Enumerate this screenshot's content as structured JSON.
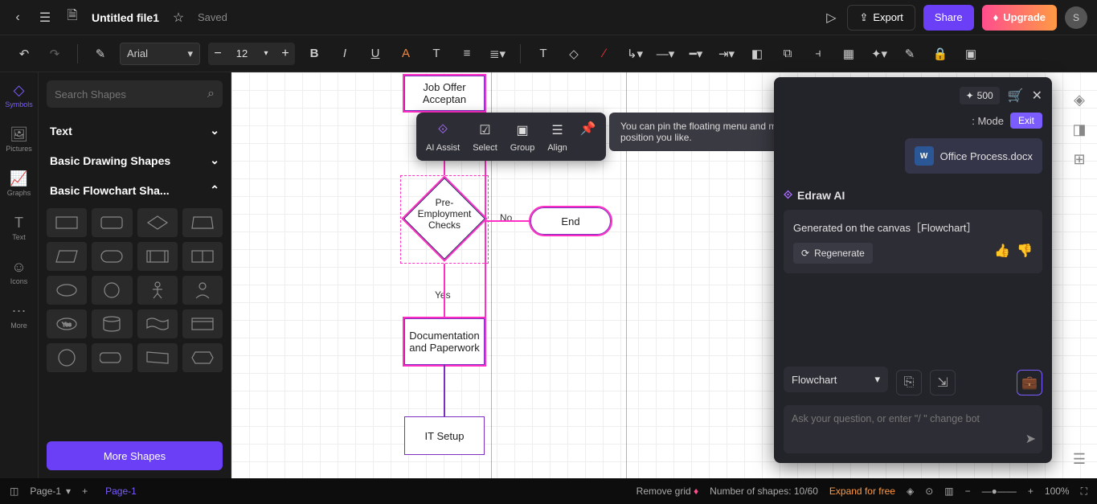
{
  "topbar": {
    "title": "Untitled file1",
    "saved": "Saved",
    "export": "Export",
    "share": "Share",
    "upgrade": "Upgrade",
    "avatar": "S"
  },
  "toolbar": {
    "font": "Arial",
    "size": "12"
  },
  "rail": [
    {
      "label": "Symbols",
      "active": true
    },
    {
      "label": "Pictures",
      "active": false
    },
    {
      "label": "Graphs",
      "active": false
    },
    {
      "label": "Text",
      "active": false
    },
    {
      "label": "Icons",
      "active": false
    },
    {
      "label": "More",
      "active": false
    }
  ],
  "sidebar": {
    "search_placeholder": "Search Shapes",
    "categories": [
      "Text",
      "Basic Drawing Shapes",
      "Basic Flowchart Sha..."
    ],
    "more": "More Shapes"
  },
  "canvas": {
    "nodes": {
      "offer": "Job Offer Acceptan",
      "checks": "Pre-Employment Checks",
      "docs": "Documentation and Paperwork",
      "it": "IT Setup",
      "end": "End"
    },
    "edges": {
      "no": "No",
      "yes": "Yes"
    }
  },
  "float_menu": {
    "items": [
      "AI Assist",
      "Select",
      "Group",
      "Align"
    ],
    "tooltip": "You can pin the floating menu and move it to any position you like."
  },
  "ai": {
    "credits": "500",
    "mode": ": Mode",
    "exit": "Exit",
    "file": "Office Process.docx",
    "title": "Edraw AI",
    "generated": "Generated on the canvas［Flowchart］",
    "regenerate": "Regenerate",
    "type": "Flowchart",
    "placeholder": "Ask your question, or enter  \"/ \" change bot"
  },
  "status": {
    "page_select": "Page-1",
    "page_tab": "Page-1",
    "remove_grid": "Remove grid",
    "shapes": "Number of shapes: 10/60",
    "expand": "Expand for free",
    "zoom": "100%"
  }
}
